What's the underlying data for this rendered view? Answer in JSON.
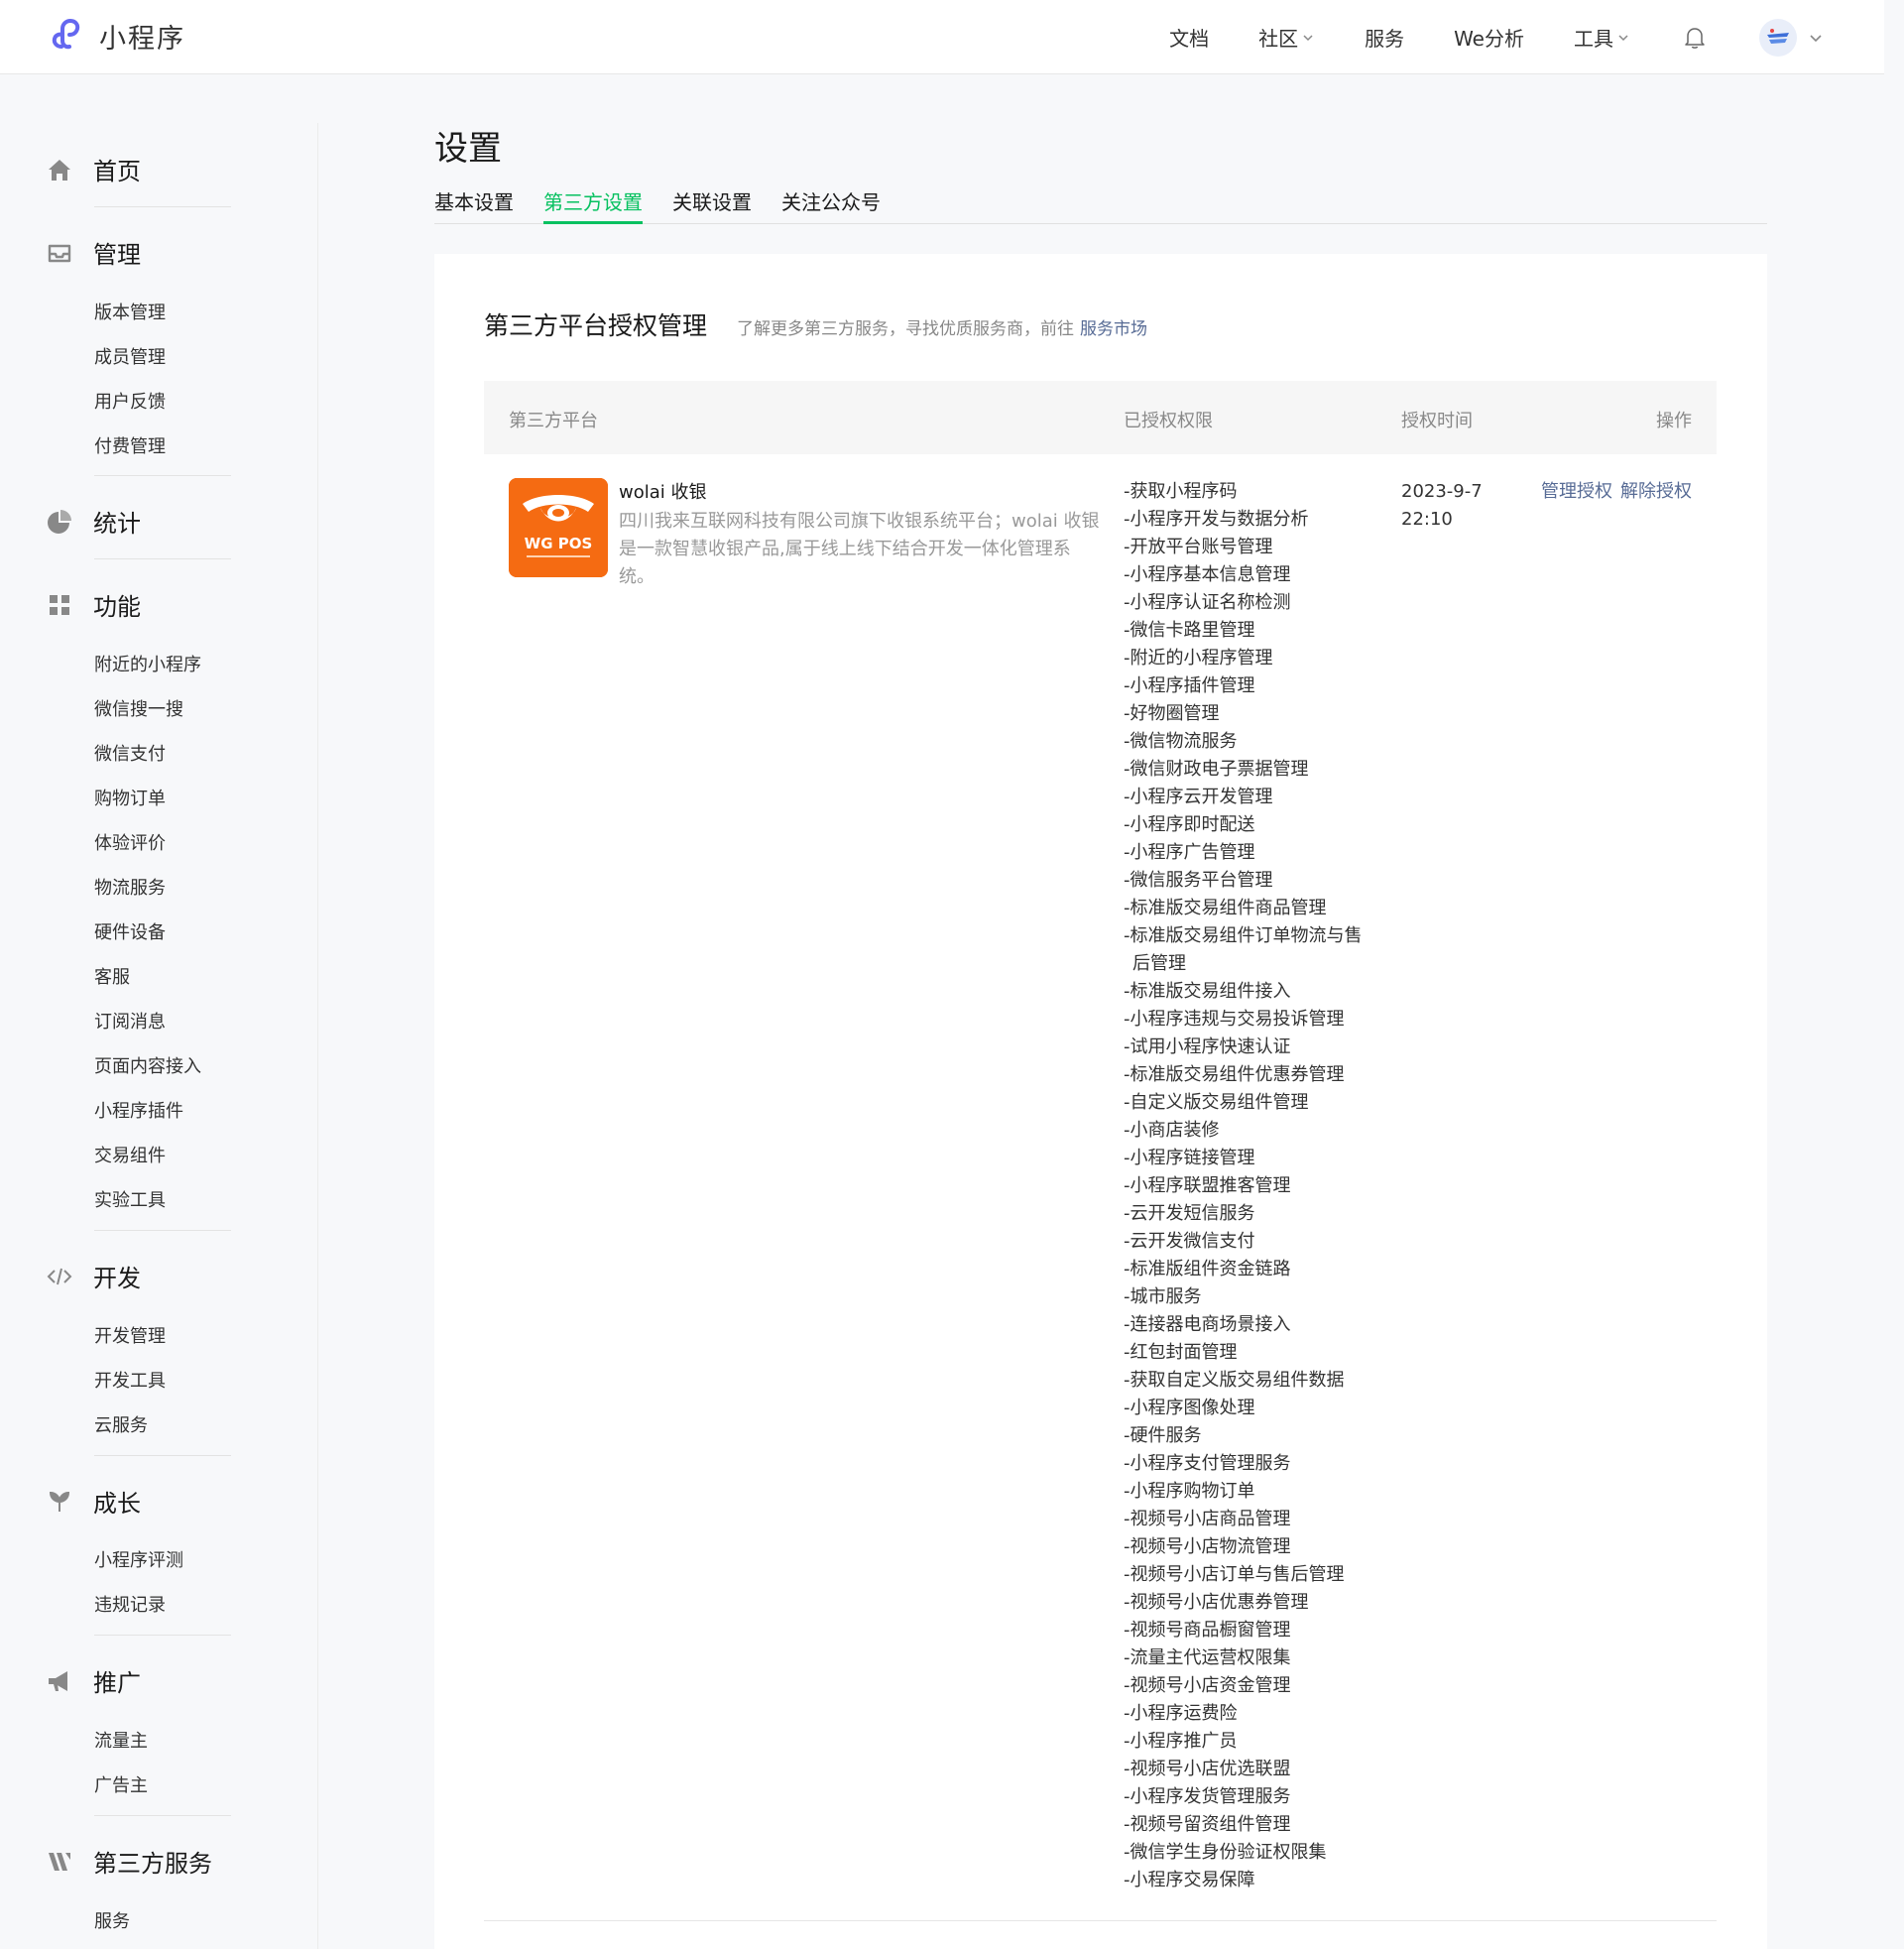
{
  "header": {
    "logo_text": "小程序",
    "nav": [
      {
        "label": "文档",
        "has_menu": false
      },
      {
        "label": "社区",
        "has_menu": true
      },
      {
        "label": "服务",
        "has_menu": false
      },
      {
        "label": "We分析",
        "has_menu": false
      },
      {
        "label": "工具",
        "has_menu": true
      }
    ]
  },
  "sidebar": {
    "home": "首页",
    "manage": {
      "label": "管理",
      "items": [
        "版本管理",
        "成员管理",
        "用户反馈",
        "付费管理"
      ]
    },
    "stats": "统计",
    "features": {
      "label": "功能",
      "items": [
        "附近的小程序",
        "微信搜一搜",
        "微信支付",
        "购物订单",
        "体验评价",
        "物流服务",
        "硬件设备",
        "客服",
        "订阅消息",
        "页面内容接入",
        "小程序插件",
        "交易组件",
        "实验工具"
      ]
    },
    "dev": {
      "label": "开发",
      "items": [
        "开发管理",
        "开发工具",
        "云服务"
      ]
    },
    "growth": {
      "label": "成长",
      "items": [
        "小程序评测",
        "违规记录"
      ]
    },
    "promo": {
      "label": "推广",
      "items": [
        "流量主",
        "广告主"
      ]
    },
    "third": {
      "label": "第三方服务",
      "items": [
        "服务"
      ]
    }
  },
  "main": {
    "title": "设置",
    "tabs": [
      {
        "label": "基本设置",
        "active": false
      },
      {
        "label": "第三方设置",
        "active": true
      },
      {
        "label": "关联设置",
        "active": false
      },
      {
        "label": "关注公众号",
        "active": false
      }
    ],
    "card": {
      "title": "第三方平台授权管理",
      "subtitle": "了解更多第三方服务，寻找优质服务商，前往",
      "subtitle_link": "服务市场",
      "columns": {
        "platform": "第三方平台",
        "perms": "已授权权限",
        "time": "授权时间",
        "ops": "操作"
      },
      "row": {
        "logo_text": "WG POS",
        "name": "wolai 收银",
        "desc": "四川我来互联网科技有限公司旗下收银系统平台；wolai 收银是一款智慧收银产品,属于线上线下结合开发一体化管理系统。",
        "time_date": "2023-9-7",
        "time_clock": "22:10",
        "op_manage": "管理授权",
        "op_revoke": "解除授权",
        "permissions": [
          "-获取小程序码",
          "-小程序开发与数据分析",
          "-开放平台账号管理",
          "-小程序基本信息管理",
          "-小程序认证名称检测",
          "-微信卡路里管理",
          "-附近的小程序管理",
          "-小程序插件管理",
          "-好物圈管理",
          "-微信物流服务",
          "-微信财政电子票据管理",
          "-小程序云开发管理",
          "-小程序即时配送",
          "-小程序广告管理",
          "-微信服务平台管理",
          "-标准版交易组件商品管理",
          "-标准版交易组件订单物流与售后管理",
          "-标准版交易组件接入",
          "-小程序违规与交易投诉管理",
          "-试用小程序快速认证",
          "-标准版交易组件优惠券管理",
          "-自定义版交易组件管理",
          "-小商店装修",
          "-小程序链接管理",
          "-小程序联盟推客管理",
          "-云开发短信服务",
          "-云开发微信支付",
          "-标准版组件资金链路",
          "-城市服务",
          "-连接器电商场景接入",
          "-红包封面管理",
          "-获取自定义版交易组件数据",
          "-小程序图像处理",
          "-硬件服务",
          "-小程序支付管理服务",
          "-小程序购物订单",
          "-视频号小店商品管理",
          "-视频号小店物流管理",
          "-视频号小店订单与售后管理",
          "-视频号小店优惠券管理",
          "-视频号商品橱窗管理",
          "-流量主代运营权限集",
          "-视频号小店资金管理",
          "-小程序运费险",
          "-小程序推广员",
          "-视频号小店优选联盟",
          "-小程序发货管理服务",
          "-视频号留资组件管理",
          "-微信学生身份验证权限集",
          "-小程序交易保障"
        ]
      }
    }
  },
  "colors": {
    "accent": "#07c160",
    "link": "#576b95",
    "app_logo_bg": "#f56b12"
  }
}
